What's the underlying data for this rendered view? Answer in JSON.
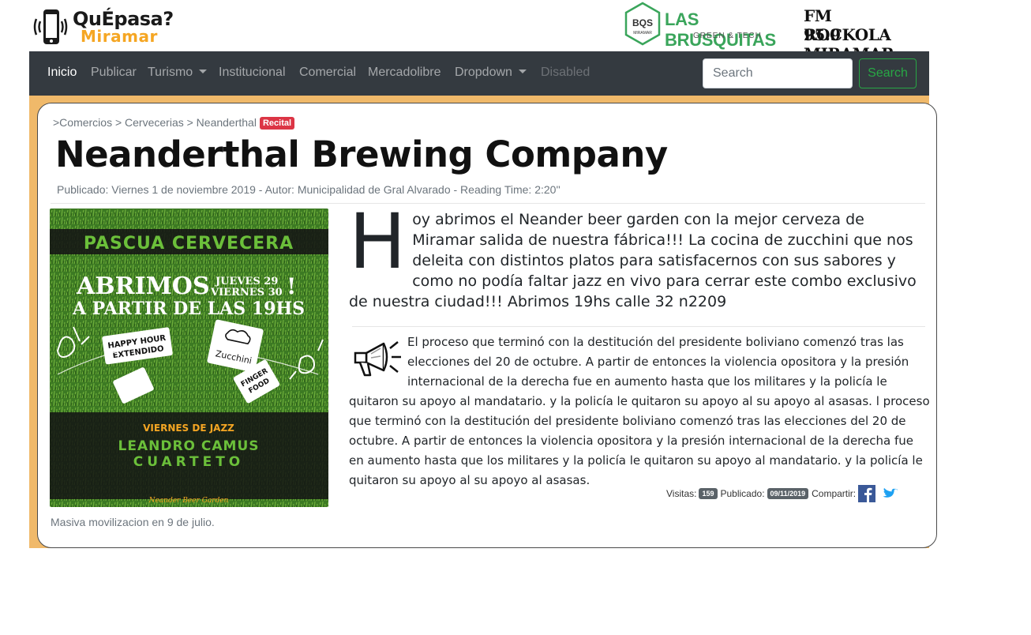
{
  "header": {
    "logo_line1": "QuÉpasa?",
    "logo_line2": "Miramar",
    "sponsor1_name": "LAS BRUSQUITAS",
    "sponsor1_sub": "GREEN & TECH",
    "sponsor1_badge": "BQS",
    "sponsor1_badge_sub": "MIRAMAR",
    "sponsor2_line1": "FM ROCKOLA",
    "sponsor2_line2": "95.9 MIRAMAR"
  },
  "nav": {
    "items": [
      {
        "label": "Inicio"
      },
      {
        "label": "Publicar"
      },
      {
        "label": "Turismo"
      },
      {
        "label": "Institucional"
      },
      {
        "label": "Comercial"
      },
      {
        "label": "Mercadolibre"
      },
      {
        "label": "Dropdown"
      },
      {
        "label": "Disabled"
      }
    ],
    "search_placeholder": "Search",
    "search_button": "Search"
  },
  "article": {
    "breadcrumb": ">Comercios > Cervecerias > Neanderthal",
    "badge": "Recital",
    "title": "Neanderthal Brewing Company",
    "meta": "Publicado: Viernes 1 de noviembre 2019 - Autor: Municipalidad de Gral Alvarado - Reading Time: 2:20''",
    "image_caption": "Masiva movilizacion en 9 de julio.",
    "dropcap": "H",
    "lead": "oy abrimos el Neander beer garden con la mejor cerveza de Miramar salida de nuestra fábrica!!! La cocina de zucchini que nos deleita con distintos platos para satisfacernos con sus sabores y como no podía faltar jazz en vivo para cerrar este combo exclusivo de nuestra ciudad!!! Abrimos 19hs calle 32 n2209",
    "body": "El proceso que terminó con la destitución del presidente boliviano comenzó tras las elecciones del 20 de octubre. A partir de entonces la violencia opositora y la presión internacional de la derecha fue en aumento hasta que los militares y la policía le quitaron su apoyo al mandatario. y la policía le quitaron su apoyo al su apoyo al asasas. l proceso que terminó con la destitución del presidente boliviano comenzó tras las elecciones del 20 de octubre. A partir de entonces la violencia opositora y la presión internacional de la derecha fue en aumento hasta que los militares y la policía le quitaron su apoyo al mandatario. y la policía le quitaron su apoyo al su apoyo al asasas.",
    "visits_label": "Visitas:",
    "visits": "159",
    "published_label": "Publicado:",
    "published_date": "09/11/2019",
    "share_label": "Compartir:"
  },
  "poster": {
    "title": "PASCUA CERVECERA",
    "abrimos": "ABRIMOS",
    "day1": "JUEVES 29",
    "day2": "VIERNES 30",
    "excl": "!",
    "time": "A PARTIR DE LAS 19HS",
    "tag1_line1": "HAPPY HOUR",
    "tag1_line2": "EXTENDIDO",
    "tag2": "Zucchini",
    "tag3_line1": "FINGER",
    "tag3_line2": "FOOD",
    "jazz": "VIERNES DE JAZZ",
    "band1": "LEANDRO CAMUS",
    "band2": "CUARTETO",
    "garden": "Neander Beer Garden"
  },
  "colors": {
    "navbar_bg": "#343a40",
    "frame_bg": "#f0b96a",
    "success": "#28a745",
    "badge_red": "#dc3545",
    "logo_orange": "#f5a623",
    "sponsor_green": "#3aa55b",
    "facebook": "#3b5998",
    "twitter": "#1da1f2"
  },
  "icons": [
    "phone-icon",
    "hexagon-logo-icon",
    "caret-down-icon",
    "megaphone-icon",
    "facebook-icon",
    "twitter-icon"
  ]
}
